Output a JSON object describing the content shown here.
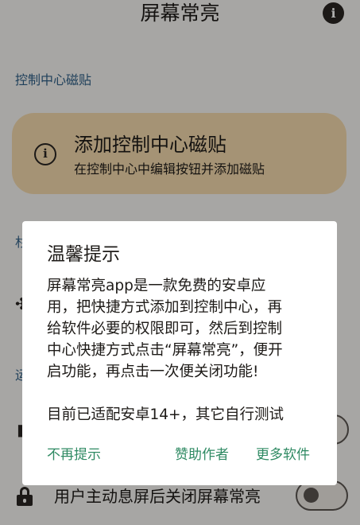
{
  "header": {
    "title": "屏幕常亮",
    "info_icon": "info-icon",
    "info_glyph": "i"
  },
  "sections": {
    "control_center_label": "控制中心磁贴",
    "second_label_fragment": "杉",
    "third_label_fragment": "运"
  },
  "tile": {
    "icon": "info-outline-icon",
    "icon_glyph": "i",
    "title": "添加控制中心磁贴",
    "subtitle": "在控制中心中编辑按钮并添加磁贴"
  },
  "settings": {
    "row1_icon": "puzzle-icon",
    "row1_glyph": "✣",
    "row2_icon": "document-icon",
    "row2_glyph": "▮",
    "lock_row": {
      "icon": "lock-icon",
      "label": "用户主动息屏后关闭屏幕常亮",
      "switch_on": false
    },
    "upper_switch_on": false
  },
  "dialog": {
    "title": "温馨提示",
    "body_lines": [
      "屏幕常亮app是一款免费的安卓应",
      "用，把快捷方式添加到控制中心，再",
      "给软件必要的权限即可，然后到控制",
      "中心快捷方式点击“屏幕常亮”，便开",
      "启功能，再点击一次便关闭功能!",
      "目前已适配安卓14+，其它自行测试"
    ],
    "buttons": {
      "dismiss": "不再提示",
      "sponsor": "赞助作者",
      "more": "更多软件"
    },
    "accent_color": "#2f8a63"
  },
  "colors": {
    "tile_background": "#f4d9ad",
    "section_label": "#2f5f86",
    "scrim": "rgba(0,0,0,0.32)"
  }
}
